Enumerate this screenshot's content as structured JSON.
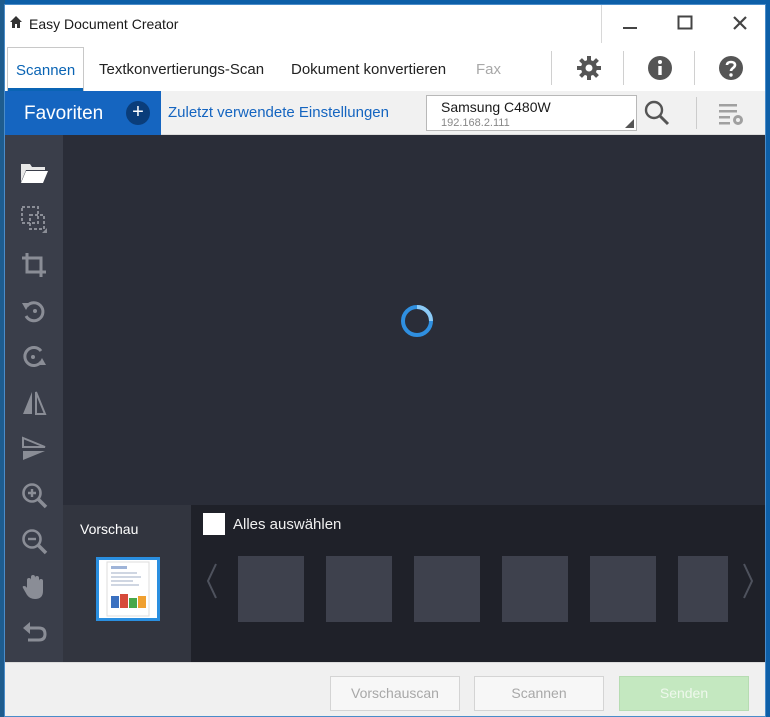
{
  "window": {
    "title": "Easy Document Creator"
  },
  "tabs": [
    {
      "label": "Scannen",
      "state": "active"
    },
    {
      "label": "Textkonvertierungs-Scan",
      "state": "normal"
    },
    {
      "label": "Dokument konvertieren",
      "state": "normal"
    },
    {
      "label": "Fax",
      "state": "disabled"
    }
  ],
  "header_icons": [
    "gear-icon",
    "info-icon",
    "help-icon"
  ],
  "favorites": {
    "label": "Favoriten",
    "add_symbol": "+",
    "recent_link": "Zuletzt verwendete Einstellungen"
  },
  "device": {
    "name": "Samsung C480W",
    "ip": "192.168.2.111"
  },
  "toolbar_icons": [
    "folder-open-icon",
    "select-area-icon",
    "crop-icon",
    "rotate-left-icon",
    "rotate-right-icon",
    "flip-horizontal-icon",
    "flip-vertical-icon",
    "zoom-in-icon",
    "zoom-out-icon",
    "hand-pan-icon",
    "undo-icon"
  ],
  "preview": {
    "label": "Vorschau"
  },
  "selection": {
    "select_all_label": "Alles auswählen"
  },
  "footer": {
    "prescan_label": "Vorschauscan",
    "scan_label": "Scannen",
    "send_label": "Senden"
  },
  "colors": {
    "accent": "#1565c0",
    "canvas": "#2a2d38",
    "toolbar": "#3a3e4a",
    "send_button": "#c4e8c0"
  }
}
